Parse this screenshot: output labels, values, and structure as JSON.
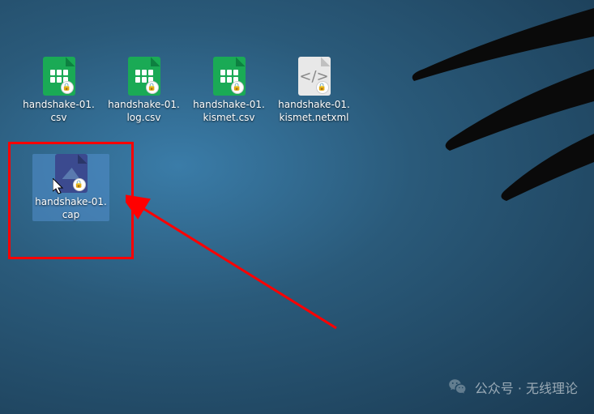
{
  "files": {
    "row1": [
      {
        "name": "handshake-01.\ncsv",
        "type": "spreadsheet"
      },
      {
        "name": "handshake-01.\nlog.csv",
        "type": "spreadsheet"
      },
      {
        "name": "handshake-01.\nkismet.csv",
        "type": "spreadsheet"
      },
      {
        "name": "handshake-01.\nkismet.netxml",
        "type": "xml"
      }
    ],
    "row2": [
      {
        "name": "handshake-01.\ncap",
        "type": "pcap",
        "selected": true
      }
    ]
  },
  "watermark": {
    "text": "公众号 · 无线理论"
  },
  "annotation": {
    "highlight_box": true,
    "arrow": true
  }
}
